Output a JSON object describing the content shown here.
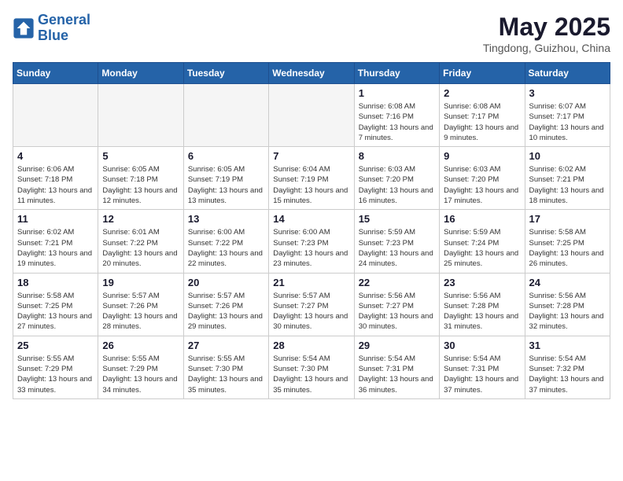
{
  "header": {
    "logo_line1": "General",
    "logo_line2": "Blue",
    "month": "May 2025",
    "location": "Tingdong, Guizhou, China"
  },
  "weekdays": [
    "Sunday",
    "Monday",
    "Tuesday",
    "Wednesday",
    "Thursday",
    "Friday",
    "Saturday"
  ],
  "weeks": [
    [
      {
        "day": "",
        "sunrise": "",
        "sunset": "",
        "daylight": ""
      },
      {
        "day": "",
        "sunrise": "",
        "sunset": "",
        "daylight": ""
      },
      {
        "day": "",
        "sunrise": "",
        "sunset": "",
        "daylight": ""
      },
      {
        "day": "",
        "sunrise": "",
        "sunset": "",
        "daylight": ""
      },
      {
        "day": "1",
        "sunrise": "Sunrise: 6:08 AM",
        "sunset": "Sunset: 7:16 PM",
        "daylight": "Daylight: 13 hours and 7 minutes."
      },
      {
        "day": "2",
        "sunrise": "Sunrise: 6:08 AM",
        "sunset": "Sunset: 7:17 PM",
        "daylight": "Daylight: 13 hours and 9 minutes."
      },
      {
        "day": "3",
        "sunrise": "Sunrise: 6:07 AM",
        "sunset": "Sunset: 7:17 PM",
        "daylight": "Daylight: 13 hours and 10 minutes."
      }
    ],
    [
      {
        "day": "4",
        "sunrise": "Sunrise: 6:06 AM",
        "sunset": "Sunset: 7:18 PM",
        "daylight": "Daylight: 13 hours and 11 minutes."
      },
      {
        "day": "5",
        "sunrise": "Sunrise: 6:05 AM",
        "sunset": "Sunset: 7:18 PM",
        "daylight": "Daylight: 13 hours and 12 minutes."
      },
      {
        "day": "6",
        "sunrise": "Sunrise: 6:05 AM",
        "sunset": "Sunset: 7:19 PM",
        "daylight": "Daylight: 13 hours and 13 minutes."
      },
      {
        "day": "7",
        "sunrise": "Sunrise: 6:04 AM",
        "sunset": "Sunset: 7:19 PM",
        "daylight": "Daylight: 13 hours and 15 minutes."
      },
      {
        "day": "8",
        "sunrise": "Sunrise: 6:03 AM",
        "sunset": "Sunset: 7:20 PM",
        "daylight": "Daylight: 13 hours and 16 minutes."
      },
      {
        "day": "9",
        "sunrise": "Sunrise: 6:03 AM",
        "sunset": "Sunset: 7:20 PM",
        "daylight": "Daylight: 13 hours and 17 minutes."
      },
      {
        "day": "10",
        "sunrise": "Sunrise: 6:02 AM",
        "sunset": "Sunset: 7:21 PM",
        "daylight": "Daylight: 13 hours and 18 minutes."
      }
    ],
    [
      {
        "day": "11",
        "sunrise": "Sunrise: 6:02 AM",
        "sunset": "Sunset: 7:21 PM",
        "daylight": "Daylight: 13 hours and 19 minutes."
      },
      {
        "day": "12",
        "sunrise": "Sunrise: 6:01 AM",
        "sunset": "Sunset: 7:22 PM",
        "daylight": "Daylight: 13 hours and 20 minutes."
      },
      {
        "day": "13",
        "sunrise": "Sunrise: 6:00 AM",
        "sunset": "Sunset: 7:22 PM",
        "daylight": "Daylight: 13 hours and 22 minutes."
      },
      {
        "day": "14",
        "sunrise": "Sunrise: 6:00 AM",
        "sunset": "Sunset: 7:23 PM",
        "daylight": "Daylight: 13 hours and 23 minutes."
      },
      {
        "day": "15",
        "sunrise": "Sunrise: 5:59 AM",
        "sunset": "Sunset: 7:23 PM",
        "daylight": "Daylight: 13 hours and 24 minutes."
      },
      {
        "day": "16",
        "sunrise": "Sunrise: 5:59 AM",
        "sunset": "Sunset: 7:24 PM",
        "daylight": "Daylight: 13 hours and 25 minutes."
      },
      {
        "day": "17",
        "sunrise": "Sunrise: 5:58 AM",
        "sunset": "Sunset: 7:25 PM",
        "daylight": "Daylight: 13 hours and 26 minutes."
      }
    ],
    [
      {
        "day": "18",
        "sunrise": "Sunrise: 5:58 AM",
        "sunset": "Sunset: 7:25 PM",
        "daylight": "Daylight: 13 hours and 27 minutes."
      },
      {
        "day": "19",
        "sunrise": "Sunrise: 5:57 AM",
        "sunset": "Sunset: 7:26 PM",
        "daylight": "Daylight: 13 hours and 28 minutes."
      },
      {
        "day": "20",
        "sunrise": "Sunrise: 5:57 AM",
        "sunset": "Sunset: 7:26 PM",
        "daylight": "Daylight: 13 hours and 29 minutes."
      },
      {
        "day": "21",
        "sunrise": "Sunrise: 5:57 AM",
        "sunset": "Sunset: 7:27 PM",
        "daylight": "Daylight: 13 hours and 30 minutes."
      },
      {
        "day": "22",
        "sunrise": "Sunrise: 5:56 AM",
        "sunset": "Sunset: 7:27 PM",
        "daylight": "Daylight: 13 hours and 30 minutes."
      },
      {
        "day": "23",
        "sunrise": "Sunrise: 5:56 AM",
        "sunset": "Sunset: 7:28 PM",
        "daylight": "Daylight: 13 hours and 31 minutes."
      },
      {
        "day": "24",
        "sunrise": "Sunrise: 5:56 AM",
        "sunset": "Sunset: 7:28 PM",
        "daylight": "Daylight: 13 hours and 32 minutes."
      }
    ],
    [
      {
        "day": "25",
        "sunrise": "Sunrise: 5:55 AM",
        "sunset": "Sunset: 7:29 PM",
        "daylight": "Daylight: 13 hours and 33 minutes."
      },
      {
        "day": "26",
        "sunrise": "Sunrise: 5:55 AM",
        "sunset": "Sunset: 7:29 PM",
        "daylight": "Daylight: 13 hours and 34 minutes."
      },
      {
        "day": "27",
        "sunrise": "Sunrise: 5:55 AM",
        "sunset": "Sunset: 7:30 PM",
        "daylight": "Daylight: 13 hours and 35 minutes."
      },
      {
        "day": "28",
        "sunrise": "Sunrise: 5:54 AM",
        "sunset": "Sunset: 7:30 PM",
        "daylight": "Daylight: 13 hours and 35 minutes."
      },
      {
        "day": "29",
        "sunrise": "Sunrise: 5:54 AM",
        "sunset": "Sunset: 7:31 PM",
        "daylight": "Daylight: 13 hours and 36 minutes."
      },
      {
        "day": "30",
        "sunrise": "Sunrise: 5:54 AM",
        "sunset": "Sunset: 7:31 PM",
        "daylight": "Daylight: 13 hours and 37 minutes."
      },
      {
        "day": "31",
        "sunrise": "Sunrise: 5:54 AM",
        "sunset": "Sunset: 7:32 PM",
        "daylight": "Daylight: 13 hours and 37 minutes."
      }
    ]
  ]
}
